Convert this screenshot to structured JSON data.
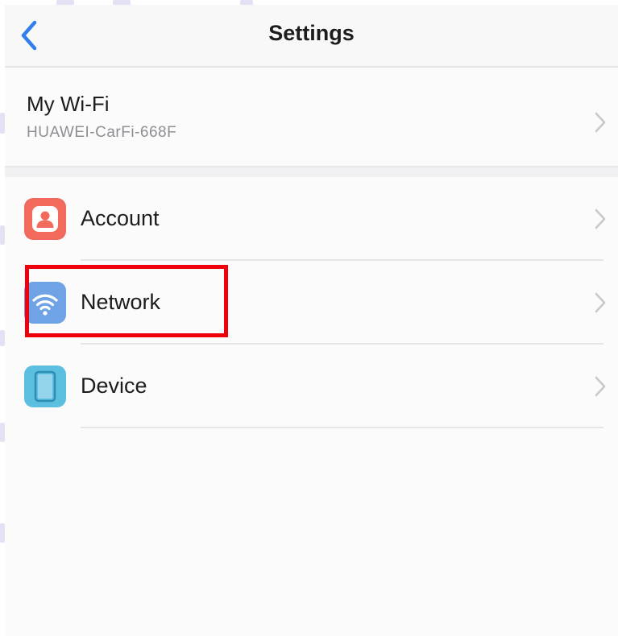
{
  "header": {
    "title": "Settings",
    "back_icon": "chevron-left-icon",
    "accent_color": "#2f80ed"
  },
  "wifi": {
    "title": "My Wi-Fi",
    "ssid": "HUAWEI-CarFi-668F"
  },
  "menu": {
    "items": [
      {
        "label": "Account",
        "icon": "account-icon",
        "icon_color": "#f26a5b"
      },
      {
        "label": "Network",
        "icon": "wifi-icon",
        "icon_color": "#6fa3e5"
      },
      {
        "label": "Device",
        "icon": "device-icon",
        "icon_color": "#5cbfe0"
      }
    ]
  },
  "highlight": {
    "target": "Network",
    "color": "#f0000a"
  }
}
